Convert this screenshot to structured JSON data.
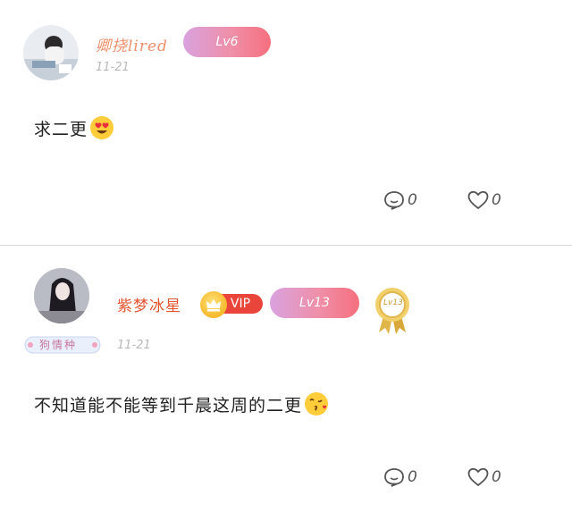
{
  "comments": [
    {
      "username": "卿挠lired",
      "level_badge": "Lv6",
      "date": "11-21",
      "text": "求二更",
      "emoji": "heart-eyes-emoji",
      "reply_count": "0",
      "like_count": "0"
    },
    {
      "username": "紫梦冰星",
      "vip_label": "VIP",
      "level_badge": "Lv13",
      "medal_text": "Lv13",
      "fan_tag": "狗情种",
      "date": "11-21",
      "text": "不知道能不能等到千晨这周的二更",
      "emoji": "kissing-emoji",
      "reply_count": "0",
      "like_count": "0"
    }
  ],
  "colors": {
    "username_1": "#ee8f6a",
    "username_2": "#e4552f",
    "vip_red": "#e9453a",
    "badge_gradient_start": "#d9a2df",
    "badge_gradient_end": "#f56f7e",
    "divider": "#dcdcdc",
    "date_gray": "#b9b9b9"
  }
}
